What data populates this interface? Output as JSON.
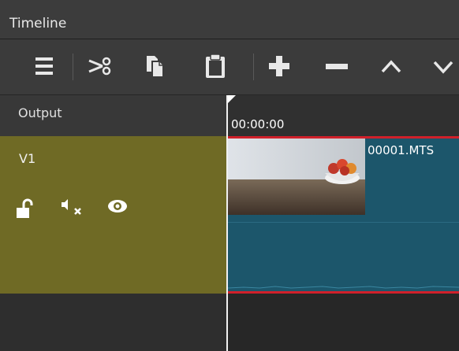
{
  "panel": {
    "title": "Timeline"
  },
  "toolbar": {
    "buttons": [
      {
        "name": "menu",
        "icon": "hamburger-menu-icon"
      },
      {
        "name": "cut",
        "icon": "scissors-icon"
      },
      {
        "name": "copy",
        "icon": "copy-icon"
      },
      {
        "name": "paste",
        "icon": "clipboard-icon"
      },
      {
        "name": "append",
        "icon": "plus-icon"
      },
      {
        "name": "remove",
        "icon": "minus-icon"
      },
      {
        "name": "lift",
        "icon": "chevron-up-icon"
      },
      {
        "name": "overwrite",
        "icon": "chevron-down-icon"
      }
    ]
  },
  "header": {
    "output_label": "Output",
    "timecode": "00:00:00"
  },
  "tracks": [
    {
      "name": "V1",
      "icons": [
        "unlock-icon",
        "mute-audio-icon",
        "eye-icon"
      ],
      "clips": [
        {
          "name": "00001.MTS"
        }
      ]
    }
  ],
  "colors": {
    "track_header": "#6f6a25",
    "clip": "#1c566b",
    "clip_border": "#d0202a",
    "toolbar": "#3b3b3b"
  }
}
